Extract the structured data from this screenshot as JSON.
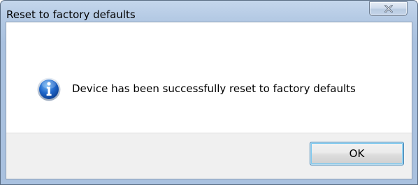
{
  "dialog": {
    "title": "Reset to factory defaults",
    "close_icon": "close-x-icon",
    "message_icon": "info-icon",
    "message": "Device has been successfully reset to factory defaults",
    "ok_label": "OK"
  }
}
